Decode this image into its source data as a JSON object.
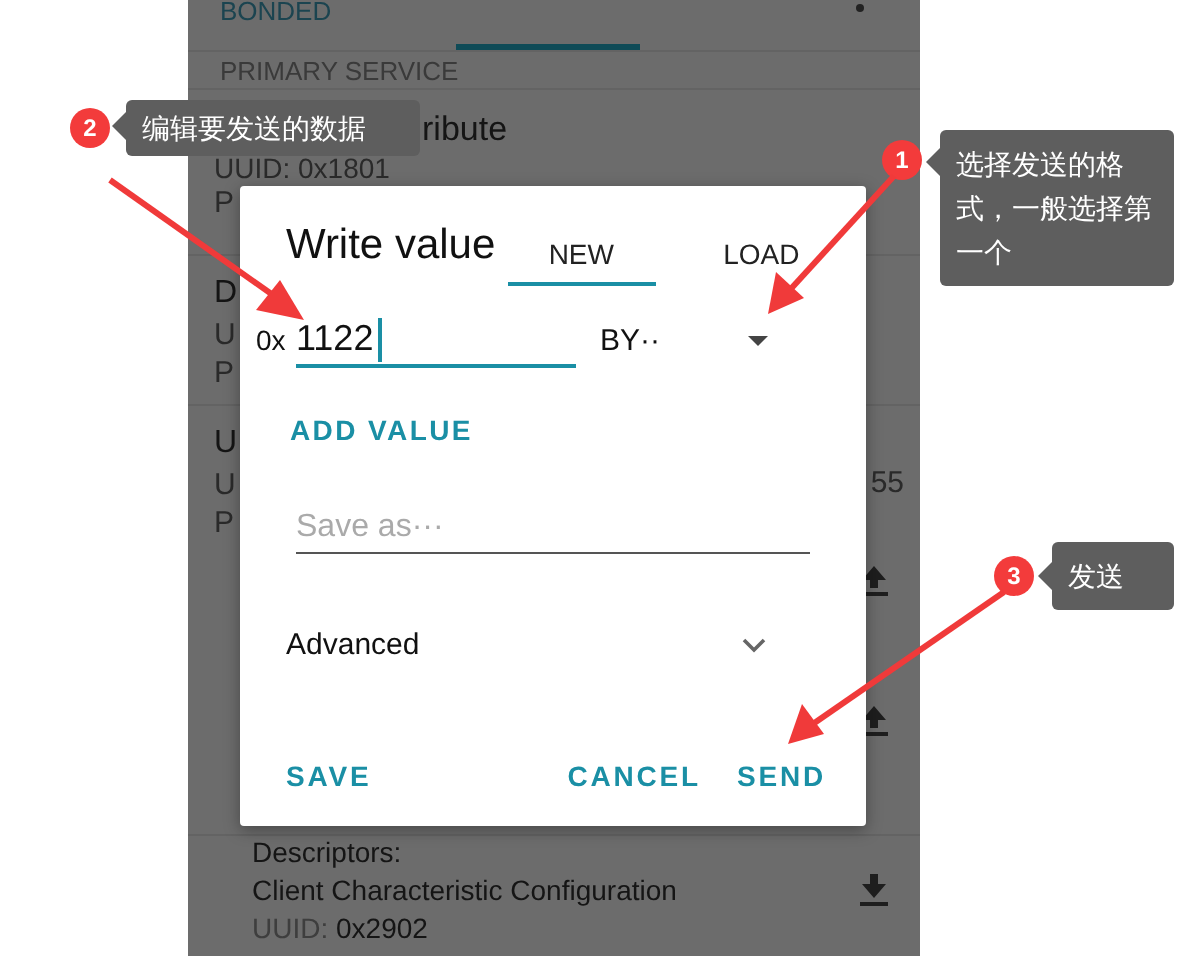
{
  "client_view": {
    "tabs": [
      {
        "label": "BONDED",
        "selected": false
      },
      {
        "selected": true
      },
      {
        "selected": false
      }
    ],
    "section_label": "PRIMARY SERVICE",
    "rows": [
      {
        "lines": [
          "ribute",
          "UUID: 0x1801",
          "P"
        ]
      },
      {
        "lines": [
          "D",
          "U",
          "P"
        ]
      },
      {
        "lines": [
          "U",
          "U",
          "P"
        ],
        "side_text": "55"
      }
    ],
    "descriptors": {
      "label": "Descriptors:",
      "name": "Client Characteristic Configuration",
      "uuid_label": "UUID:",
      "uuid": "0x2902"
    }
  },
  "dialog": {
    "title": "Write value",
    "tabs": [
      {
        "label": "NEW",
        "selected": true
      },
      {
        "label": "LOAD",
        "selected": false
      }
    ],
    "prefix": "0x",
    "value": "1122",
    "format": "BY··",
    "add_value": "ADD VALUE",
    "save_as": {
      "placeholder": "Save as···"
    },
    "advanced": {
      "label": "Advanced",
      "expanded": false
    },
    "buttons": [
      {
        "label": "SAVE"
      },
      {
        "label": "CANCEL"
      },
      {
        "label": "SEND"
      }
    ]
  },
  "annotations": [
    {
      "number": "2",
      "text": "编辑要发送的数据"
    },
    {
      "number": "1",
      "text": "选择发送的格式，一般选择第一个"
    },
    {
      "number": "3",
      "text": "发送"
    }
  ]
}
